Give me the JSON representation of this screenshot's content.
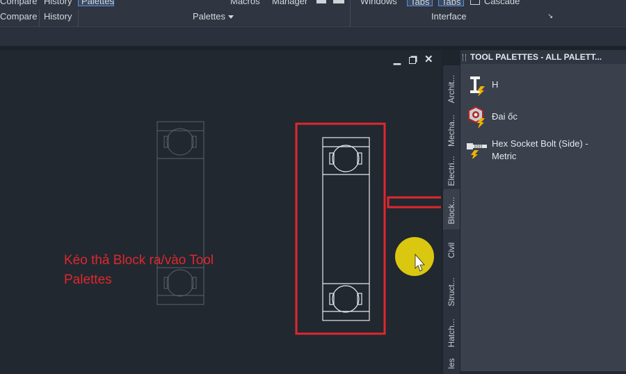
{
  "ribbon": {
    "row1": [
      {
        "label": "Compare"
      },
      {
        "label": "History"
      },
      {
        "label": "Palettes"
      },
      {
        "label": "Macros"
      },
      {
        "label": "Manager"
      },
      {
        "label": "Windows"
      },
      {
        "label": "Tabs"
      },
      {
        "label": "Tabs"
      },
      {
        "label": "Cascade"
      }
    ],
    "row2": [
      {
        "label": "Compare"
      },
      {
        "label": "History"
      }
    ],
    "panels": {
      "palettes_label": "Palettes",
      "interface_label": "Interface"
    }
  },
  "drawing_window": {
    "controls": [
      "minimize-icon",
      "restore-icon",
      "close-icon"
    ],
    "annotation": {
      "line1": "Kéo thả Block ra/vào Tool",
      "line2": "Palettes",
      "color": "#e0272d"
    }
  },
  "tool_palettes": {
    "title": "TOOL PALETTES - ALL PALETT...",
    "side_tabs": [
      {
        "label": "Archit..."
      },
      {
        "label": "Mecha..."
      },
      {
        "label": "Electri..."
      },
      {
        "label": "Block..."
      },
      {
        "label": "Civil"
      },
      {
        "label": "Struct..."
      },
      {
        "label": "Hatch..."
      },
      {
        "label": "les"
      }
    ],
    "active_tab": "Block...",
    "items": [
      {
        "label": "H",
        "icon": "i-beam-icon"
      },
      {
        "label": "Đai ốc",
        "icon": "nut-icon"
      },
      {
        "label_line1": "Hex Socket Bolt (Side) -",
        "label_line2": "Metric",
        "icon": "bolt-icon"
      }
    ]
  },
  "colors": {
    "accent_red": "#e0272d",
    "cursor_highlight": "#d9c80f",
    "panel_bg": "#3a414d",
    "canvas_bg": "#212830"
  }
}
